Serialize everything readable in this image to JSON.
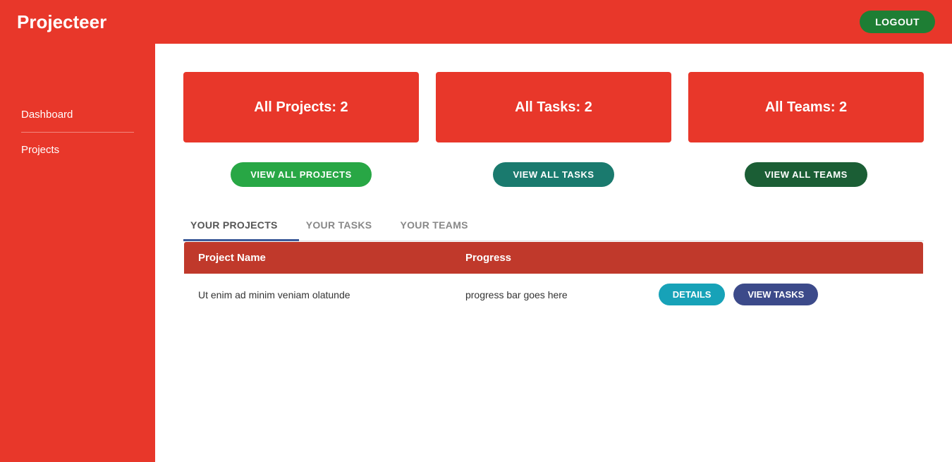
{
  "header": {
    "title": "Projecteer",
    "logout_label": "LOGOUT"
  },
  "sidebar": {
    "items": [
      {
        "label": "Dashboard",
        "name": "dashboard"
      },
      {
        "label": "Projects",
        "name": "projects"
      }
    ]
  },
  "summary_cards": [
    {
      "label": "All Projects: 2"
    },
    {
      "label": "All Tasks: 2"
    },
    {
      "label": "All Teams: 2"
    }
  ],
  "view_buttons": [
    {
      "label": "VIEW ALL PROJECTS",
      "style": "green"
    },
    {
      "label": "VIEW ALL TASKS",
      "style": "teal"
    },
    {
      "label": "VIEW ALL TEAMS",
      "style": "dark-green"
    }
  ],
  "tabs": [
    {
      "label": "YOUR PROJECTS",
      "active": true
    },
    {
      "label": "YOUR TASKS",
      "active": false
    },
    {
      "label": "YOUR TEAMS",
      "active": false
    }
  ],
  "table": {
    "headers": [
      {
        "label": "Project Name"
      },
      {
        "label": "Progress"
      },
      {
        "label": ""
      }
    ],
    "rows": [
      {
        "project_name": "Ut enim ad minim veniam olatunde",
        "progress": "progress bar goes here",
        "details_label": "DETAILS",
        "view_tasks_label": "VIEW TASKS"
      }
    ]
  }
}
